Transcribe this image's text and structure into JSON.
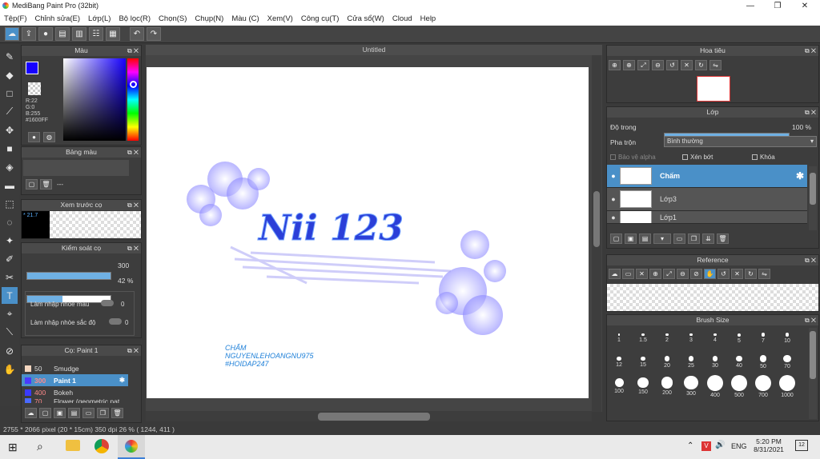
{
  "window": {
    "title": "MediBang Paint Pro (32bit)"
  },
  "menu": [
    "Tệp(F)",
    "Chỉnh sửa(E)",
    "Lớp(L)",
    "Bộ lọc(R)",
    "Chọn(S)",
    "Chụp(N)",
    "Màu (C)",
    "Xem(V)",
    "Công cụ(T)",
    "Cửa sổ(W)",
    "Cloud",
    "Help"
  ],
  "panels": {
    "color": {
      "title": "Màu",
      "r": "R:22",
      "g": "G:0",
      "b": "B:255",
      "hex": "#1600FF"
    },
    "palette": {
      "title": "Bảng màu",
      "value": "---"
    },
    "brush_preview": {
      "title": "Xem trước cọ",
      "size": "* 21.7"
    },
    "brush_control": {
      "title": "Kiểm soát cọ",
      "size": "300",
      "opacity": "42 %",
      "opacity_fraction": 0.42,
      "blur_color": "Làm nhập nhòe màu",
      "blur_color_val": "0",
      "blur_sat": "Làm nhập nhòe sắc độ",
      "blur_sat_val": "0"
    },
    "brush": {
      "title": "Cọ: Paint 1",
      "items": [
        {
          "size": "50",
          "name": "Smudge",
          "color": "#f3d6bf"
        },
        {
          "size": "300",
          "name": "Paint 1",
          "color": "#4a3aff"
        },
        {
          "size": "400",
          "name": "Bokeh",
          "color": "#3a3aff"
        },
        {
          "size": "70",
          "name": "Flower (geometric pat",
          "color": "#4a6aff"
        }
      ]
    },
    "navigator": {
      "title": "Hoa tiêu"
    },
    "layer": {
      "title": "Lớp",
      "opacity_label": "Độ trong",
      "opacity": "100 %",
      "blend_label": "Pha trộn",
      "blend": "Bình thường",
      "protect_alpha": "Bảo vệ alpha",
      "clipping": "Xén bớt",
      "lock": "Khóa",
      "layers": [
        {
          "name": "Chấm"
        },
        {
          "name": "Lớp3"
        },
        {
          "name": "Lớp1"
        }
      ]
    },
    "reference": {
      "title": "Reference"
    },
    "brush_size": {
      "title": "Brush Size",
      "sizes": [
        "1",
        "1.5",
        "2",
        "3",
        "4",
        "5",
        "7",
        "10",
        "12",
        "15",
        "20",
        "25",
        "30",
        "40",
        "50",
        "70",
        "100",
        "150",
        "200",
        "300",
        "400",
        "500",
        "700",
        "1000"
      ]
    }
  },
  "canvas": {
    "tab": "Untitled",
    "text_main": "Nii 123",
    "signature": [
      "CHẤM",
      "NGUYENLEHOANGNU975",
      "#HOIDAP247"
    ]
  },
  "status": "2755 * 2066 pixel   (20 * 15cm)   350 dpi   26 %   ( 1244, 411 )",
  "taskbar": {
    "lang": "ENG",
    "time": "5:20 PM",
    "date": "8/31/2021",
    "notif": "12"
  }
}
